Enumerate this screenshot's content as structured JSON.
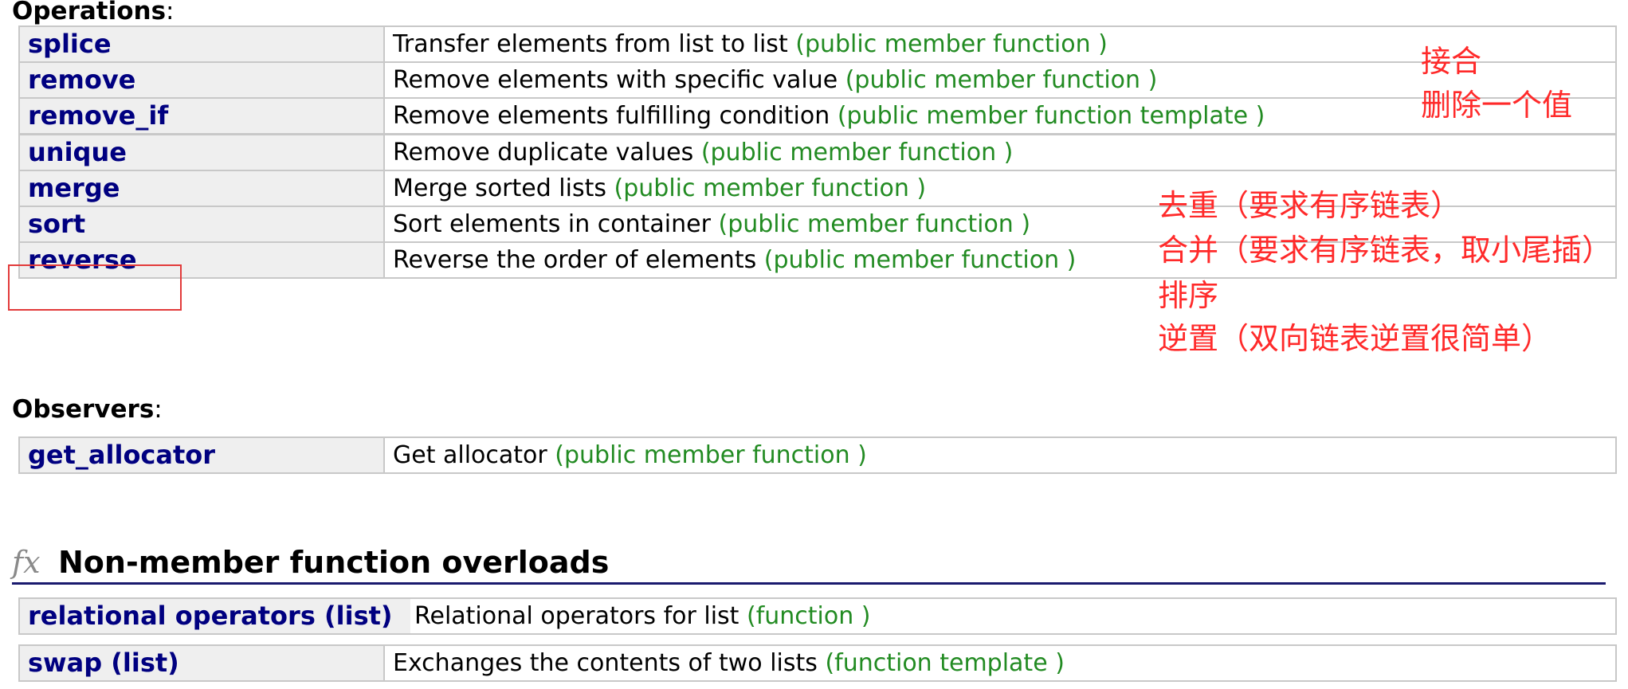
{
  "sections": {
    "operations": {
      "label": "Operations",
      "colon": ":"
    },
    "observers": {
      "label": "Observers",
      "colon": ":"
    }
  },
  "operations": [
    {
      "name": "splice",
      "desc": "Transfer elements from list to list",
      "kind": "(public member function )"
    },
    {
      "name": "remove",
      "desc": "Remove elements with specific value",
      "kind": "(public member function )"
    },
    {
      "name": "remove_if",
      "desc": "Remove elements fulfilling condition",
      "kind": "(public member function template )"
    },
    {
      "name": "unique",
      "desc": "Remove duplicate values",
      "kind": "(public member function )"
    },
    {
      "name": "merge",
      "desc": "Merge sorted lists",
      "kind": "(public member function )"
    },
    {
      "name": "sort",
      "desc": "Sort elements in container",
      "kind": "(public member function )"
    },
    {
      "name": "reverse",
      "desc": "Reverse the order of elements",
      "kind": "(public member function )"
    }
  ],
  "observers": [
    {
      "name": "get_allocator",
      "desc": "Get allocator",
      "kind": "(public member function )"
    }
  ],
  "nonmember": {
    "fx_symbol": "fx",
    "heading": "Non-member function overloads",
    "rows": [
      {
        "name": "relational operators (list)",
        "desc": "Relational operators for list",
        "kind": "(function )"
      },
      {
        "name": "swap (list)",
        "desc": "Exchanges the contents of two lists",
        "kind": "(function template )"
      }
    ]
  },
  "annotations": {
    "splice": "接合",
    "remove": "删除一个值",
    "unique": "去重（要求有序链表）",
    "merge": "合并（要求有序链表，取小尾插）",
    "sort": "排序",
    "reverse": "逆置（双向链表逆置很简单）"
  },
  "colors": {
    "name_text": "#000080",
    "kind_text": "#228b22",
    "annotation_text": "#ff2a2a",
    "name_cell_bg": "#efefef",
    "heading_rule": "#1a1a6e"
  }
}
